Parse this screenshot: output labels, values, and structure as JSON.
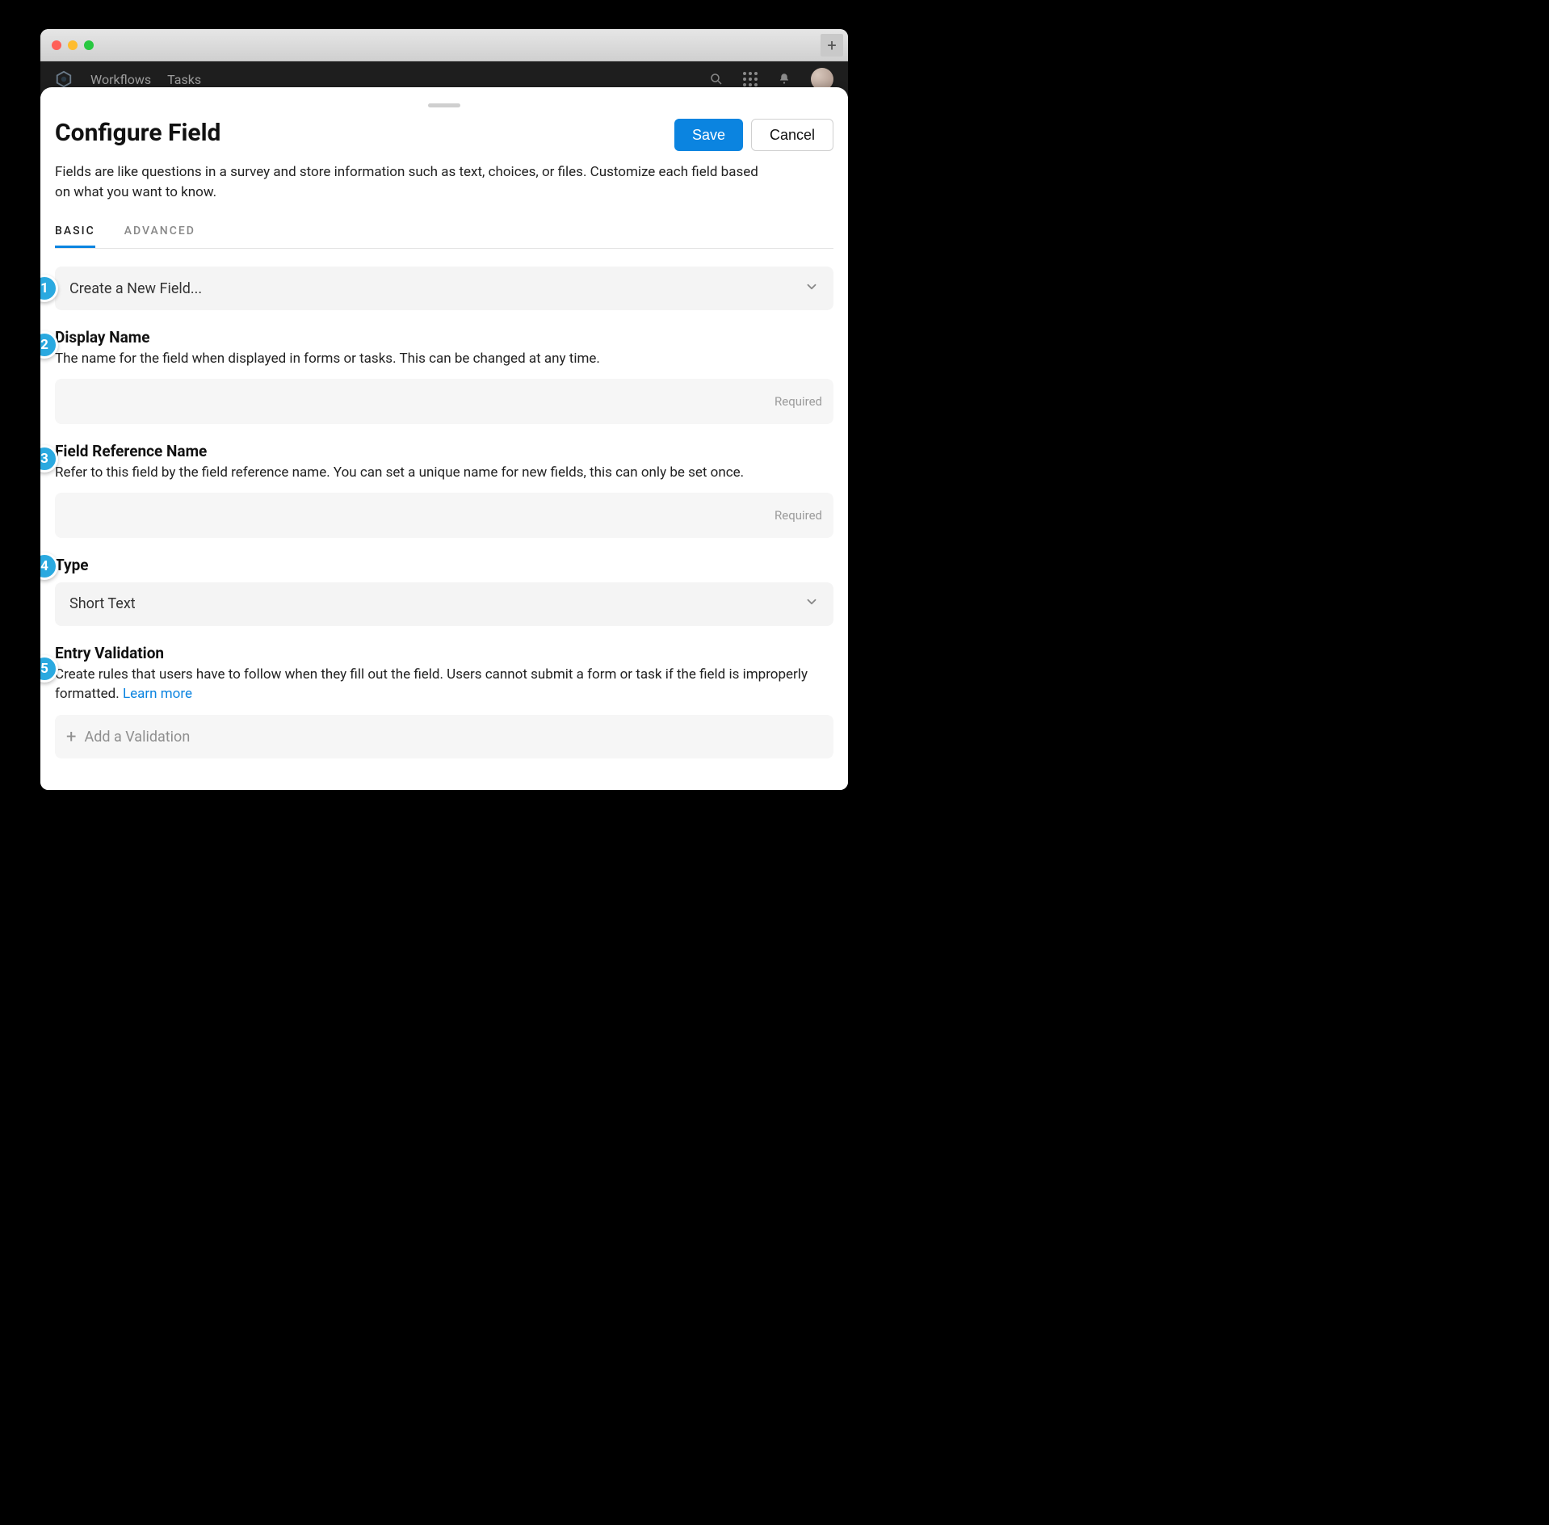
{
  "app": {
    "nav": {
      "workflows": "Workflows",
      "tasks": "Tasks"
    }
  },
  "header": {
    "title": "Configure Field",
    "save": "Save",
    "cancel": "Cancel",
    "description": "Fields are like questions in a survey and store information such as text, choices, or files. Customize each field based on what you want to know."
  },
  "tabs": {
    "basic": "BASIC",
    "advanced": "ADVANCED"
  },
  "create_field_dropdown": "Create a New Field...",
  "display_name": {
    "label": "Display Name",
    "sub": "The name for the field when displayed in forms or tasks. This can be changed at any time.",
    "placeholder_right": "Required"
  },
  "reference_name": {
    "label": "Field Reference Name",
    "sub": "Refer to this field by the field reference name. You can set a unique name for new fields, this can only be set once.",
    "placeholder_right": "Required"
  },
  "type": {
    "label": "Type",
    "value": "Short Text"
  },
  "validation": {
    "label": "Entry Validation",
    "sub_pre": "Create rules that users have to follow when they fill out the field. Users cannot submit a form or task if the field is improperly formatted. ",
    "link": "Learn more",
    "add": "Add a Validation"
  },
  "markers": {
    "m1": "1",
    "m2": "2",
    "m3": "3",
    "m4": "4",
    "m5": "5"
  }
}
